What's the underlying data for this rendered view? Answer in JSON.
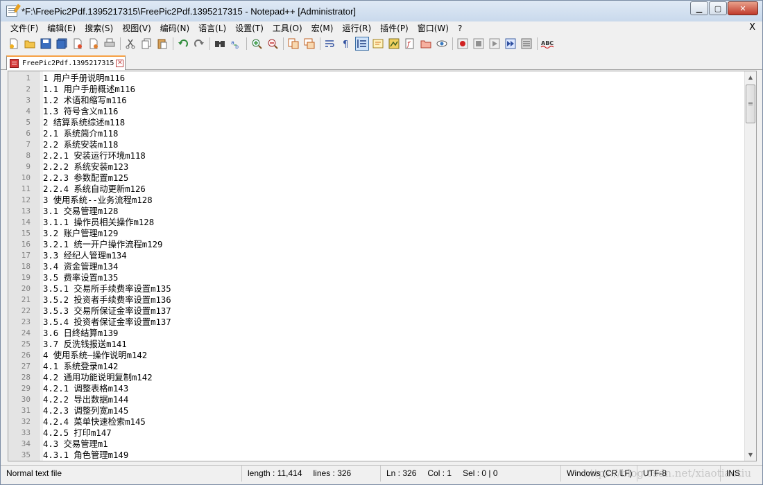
{
  "window": {
    "title": "*F:\\FreePic2Pdf.1395217315\\FreePic2Pdf.1395217315 - Notepad++ [Administrator]",
    "controls": {
      "minimize": "▁",
      "maximize": "▢",
      "close": "✕"
    }
  },
  "menu": {
    "items": [
      "文件(F)",
      "编辑(E)",
      "搜索(S)",
      "视图(V)",
      "编码(N)",
      "语言(L)",
      "设置(T)",
      "工具(O)",
      "宏(M)",
      "运行(R)",
      "插件(P)",
      "窗口(W)",
      "?"
    ],
    "close_label": "X"
  },
  "toolbar": {
    "icons": [
      "new-file-icon",
      "open-file-icon",
      "save-icon",
      "save-all-icon",
      "close-icon",
      "close-all-icon",
      "print-icon",
      "cut-icon",
      "copy-icon",
      "paste-icon",
      "undo-icon",
      "redo-icon",
      "find-icon",
      "replace-icon",
      "zoom-in-icon",
      "zoom-out-icon",
      "sync-vertical-icon",
      "sync-horizontal-icon",
      "word-wrap-icon",
      "show-all-chars-icon",
      "indent-guide-icon",
      "user-language-icon",
      "doc-map-icon",
      "function-list-icon",
      "folder-workspace-icon",
      "monitor-icon",
      "record-macro-icon",
      "stop-record-icon",
      "play-macro-icon",
      "run-macro-multiple-icon",
      "save-macro-icon",
      "spell-check-icon"
    ],
    "spell_check_label": "ABC"
  },
  "tab": {
    "label": "FreePic2Pdf.1395217315",
    "close_glyph": "✕"
  },
  "editor": {
    "lines": [
      "1 用户手册说明m116",
      "1.1 用户手册概述m116",
      "1.2 术语和缩写m116",
      "1.3 符号含义m116",
      "2 结算系统综述m118",
      "2.1 系统简介m118",
      "2.2 系统安装m118",
      "2.2.1 安装运行环境m118",
      "2.2.2 系统安装m123",
      "2.2.3 参数配置m125",
      "2.2.4 系统自动更新m126",
      "3 使用系统--业务流程m128",
      "3.1 交易管理m128",
      "3.1.1 操作员相关操作m128",
      "3.2 账户管理m129",
      "3.2.1 统一开户操作流程m129",
      "3.3 经纪人管理m134",
      "3.4 资金管理m134",
      "3.5 费率设置m135",
      "3.5.1 交易所手续费率设置m135",
      "3.5.2 投资者手续费率设置m136",
      "3.5.3 交易所保证金率设置m137",
      "3.5.4 投资者保证金率设置m137",
      "3.6 日终结算m139",
      "3.7 反洗钱报送m141",
      "4 使用系统—操作说明m142",
      "4.1 系统登录m142",
      "4.2 通用功能说明复制m142",
      "4.2.1 调整表格m143",
      "4.2.2 导出数据m144",
      "4.2.3 调整列宽m145",
      "4.2.4 菜单快速检索m145",
      "4.2.5 打印m147",
      "4.3 交易管理m1",
      "4.3.1 角色管理m149"
    ],
    "line_numbers": [
      "1",
      "2",
      "3",
      "4",
      "5",
      "6",
      "7",
      "8",
      "9",
      "10",
      "11",
      "12",
      "13",
      "14",
      "15",
      "16",
      "17",
      "18",
      "19",
      "20",
      "21",
      "22",
      "23",
      "24",
      "25",
      "26",
      "27",
      "28",
      "29",
      "30",
      "31",
      "32",
      "33",
      "34",
      "35"
    ],
    "scroll_up": "▲",
    "scroll_down": "▼"
  },
  "status": {
    "file_type": "Normal text file",
    "length": "length : 11,414",
    "lines": "lines : 326",
    "ln": "Ln : 326",
    "col": "Col : 1",
    "sel": "Sel : 0 | 0",
    "eol": "Windows (CR LF)",
    "encoding": "UTF-8",
    "mode": "INS",
    "watermark": "https://blog.csdn.net/xiaotiaotiu"
  }
}
